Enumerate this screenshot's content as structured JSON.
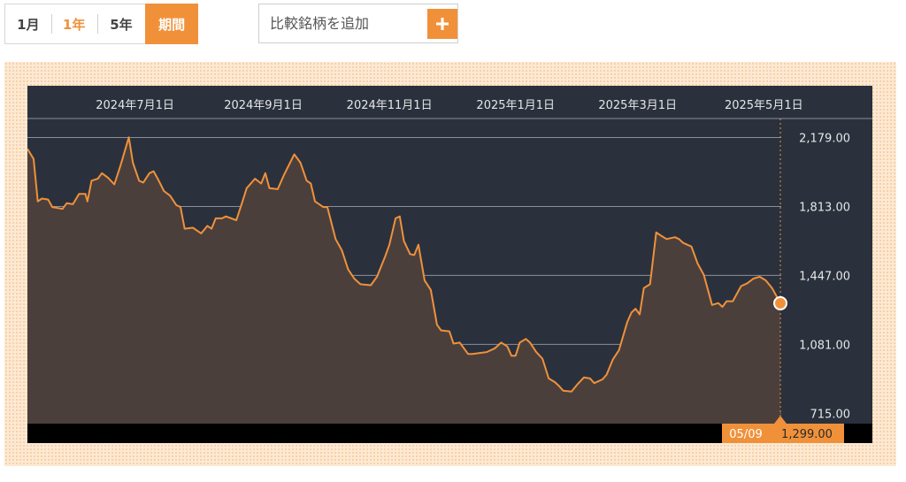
{
  "periods": [
    {
      "label": "1月"
    },
    {
      "label": "1年"
    },
    {
      "label": "5年"
    },
    {
      "label": "期間"
    }
  ],
  "compare": {
    "placeholder": "比較銘柄を追加",
    "add_icon": "plus-icon"
  },
  "colors": {
    "accent": "#f0913a",
    "chart_bg": "#2a313d",
    "area_fill": "#4b3f3c",
    "line": "#f0913a",
    "footer_bg": "#000000"
  },
  "chart_data": {
    "type": "area",
    "x_ticks": [
      "2024年7月1日",
      "2024年9月1日",
      "2024年11月1日",
      "2025年1月1日",
      "2025年3月1日",
      "2025年5月1日"
    ],
    "y_ticks": [
      "2,179.00",
      "1,813.00",
      "1,447.00",
      "1,081.00",
      "715.00"
    ],
    "ylim": [
      660,
      2280
    ],
    "x_start": "2024-05-10",
    "x_end": "2025-05-09",
    "grid": true,
    "series": [
      {
        "values": [
          [
            "2024-05-10",
            2119
          ],
          [
            "2024-05-13",
            2065
          ],
          [
            "2024-05-15",
            1840
          ],
          [
            "2024-05-17",
            1855
          ],
          [
            "2024-05-20",
            1850
          ],
          [
            "2024-05-22",
            1810
          ],
          [
            "2024-05-27",
            1800
          ],
          [
            "2024-05-29",
            1830
          ],
          [
            "2024-06-01",
            1825
          ],
          [
            "2024-06-04",
            1880
          ],
          [
            "2024-06-07",
            1880
          ],
          [
            "2024-06-08",
            1840
          ],
          [
            "2024-06-10",
            1950
          ],
          [
            "2024-06-13",
            1960
          ],
          [
            "2024-06-15",
            1990
          ],
          [
            "2024-06-18",
            1965
          ],
          [
            "2024-06-21",
            1930
          ],
          [
            "2024-06-24",
            2030
          ],
          [
            "2024-06-28",
            2180
          ],
          [
            "2024-06-30",
            2045
          ],
          [
            "2024-07-03",
            1950
          ],
          [
            "2024-07-05",
            1940
          ],
          [
            "2024-07-08",
            1990
          ],
          [
            "2024-07-10",
            2000
          ],
          [
            "2024-07-12",
            1960
          ],
          [
            "2024-07-15",
            1895
          ],
          [
            "2024-07-18",
            1870
          ],
          [
            "2024-07-21",
            1820
          ],
          [
            "2024-07-23",
            1810
          ],
          [
            "2024-07-25",
            1695
          ],
          [
            "2024-07-29",
            1700
          ],
          [
            "2024-08-02",
            1670
          ],
          [
            "2024-08-05",
            1710
          ],
          [
            "2024-08-07",
            1695
          ],
          [
            "2024-08-09",
            1750
          ],
          [
            "2024-08-12",
            1750
          ],
          [
            "2024-08-14",
            1760
          ],
          [
            "2024-08-19",
            1740
          ],
          [
            "2024-08-22",
            1840
          ],
          [
            "2024-08-24",
            1910
          ],
          [
            "2024-08-28",
            1960
          ],
          [
            "2024-08-31",
            1935
          ],
          [
            "2024-09-02",
            1990
          ],
          [
            "2024-09-04",
            1910
          ],
          [
            "2024-09-08",
            1905
          ],
          [
            "2024-09-11",
            1980
          ],
          [
            "2024-09-16",
            2090
          ],
          [
            "2024-09-19",
            2045
          ],
          [
            "2024-09-22",
            1950
          ],
          [
            "2024-09-24",
            1935
          ],
          [
            "2024-09-26",
            1840
          ],
          [
            "2024-09-30",
            1810
          ],
          [
            "2024-10-02",
            1810
          ],
          [
            "2024-10-06",
            1640
          ],
          [
            "2024-10-09",
            1580
          ],
          [
            "2024-10-12",
            1480
          ],
          [
            "2024-10-15",
            1430
          ],
          [
            "2024-10-18",
            1400
          ],
          [
            "2024-10-23",
            1395
          ],
          [
            "2024-10-26",
            1440
          ],
          [
            "2024-10-30",
            1550
          ],
          [
            "2024-11-01",
            1610
          ],
          [
            "2024-11-04",
            1750
          ],
          [
            "2024-11-06",
            1760
          ],
          [
            "2024-11-08",
            1630
          ],
          [
            "2024-11-11",
            1560
          ],
          [
            "2024-11-13",
            1555
          ],
          [
            "2024-11-15",
            1610
          ],
          [
            "2024-11-18",
            1420
          ],
          [
            "2024-11-21",
            1370
          ],
          [
            "2024-11-24",
            1185
          ],
          [
            "2024-11-26",
            1155
          ],
          [
            "2024-11-30",
            1150
          ],
          [
            "2024-12-02",
            1085
          ],
          [
            "2024-12-05",
            1090
          ],
          [
            "2024-12-09",
            1030
          ],
          [
            "2024-12-11",
            1030
          ],
          [
            "2024-12-18",
            1040
          ],
          [
            "2024-12-22",
            1060
          ],
          [
            "2024-12-25",
            1090
          ],
          [
            "2024-12-28",
            1070
          ],
          [
            "2024-12-30",
            1020
          ],
          [
            "2025-01-01",
            1020
          ],
          [
            "2025-01-03",
            1090
          ],
          [
            "2025-01-06",
            1110
          ],
          [
            "2025-01-08",
            1090
          ],
          [
            "2025-01-11",
            1040
          ],
          [
            "2025-01-14",
            1005
          ],
          [
            "2025-01-17",
            900
          ],
          [
            "2025-01-20",
            880
          ],
          [
            "2025-01-22",
            860
          ],
          [
            "2025-01-24",
            835
          ],
          [
            "2025-01-28",
            830
          ],
          [
            "2025-01-31",
            870
          ],
          [
            "2025-02-03",
            905
          ],
          [
            "2025-02-06",
            900
          ],
          [
            "2025-02-08",
            875
          ],
          [
            "2025-02-12",
            895
          ],
          [
            "2025-02-14",
            920
          ],
          [
            "2025-02-17",
            1000
          ],
          [
            "2025-02-20",
            1050
          ],
          [
            "2025-02-24",
            1200
          ],
          [
            "2025-02-26",
            1250
          ],
          [
            "2025-02-28",
            1270
          ],
          [
            "2025-03-02",
            1240
          ],
          [
            "2025-03-04",
            1380
          ],
          [
            "2025-03-07",
            1400
          ],
          [
            "2025-03-10",
            1675
          ],
          [
            "2025-03-12",
            1660
          ],
          [
            "2025-03-15",
            1640
          ],
          [
            "2025-03-19",
            1650
          ],
          [
            "2025-03-21",
            1640
          ],
          [
            "2025-03-23",
            1620
          ],
          [
            "2025-03-27",
            1600
          ],
          [
            "2025-03-30",
            1510
          ],
          [
            "2025-04-02",
            1450
          ],
          [
            "2025-04-06",
            1290
          ],
          [
            "2025-04-09",
            1300
          ],
          [
            "2025-04-11",
            1280
          ],
          [
            "2025-04-13",
            1310
          ],
          [
            "2025-04-16",
            1310
          ],
          [
            "2025-04-20",
            1390
          ],
          [
            "2025-04-23",
            1405
          ],
          [
            "2025-04-26",
            1430
          ],
          [
            "2025-04-29",
            1440
          ],
          [
            "2025-05-02",
            1420
          ],
          [
            "2025-05-05",
            1380
          ],
          [
            "2025-05-09",
            1299
          ]
        ]
      }
    ],
    "last_point": {
      "date": "05/09",
      "value": "1,299.00"
    }
  }
}
